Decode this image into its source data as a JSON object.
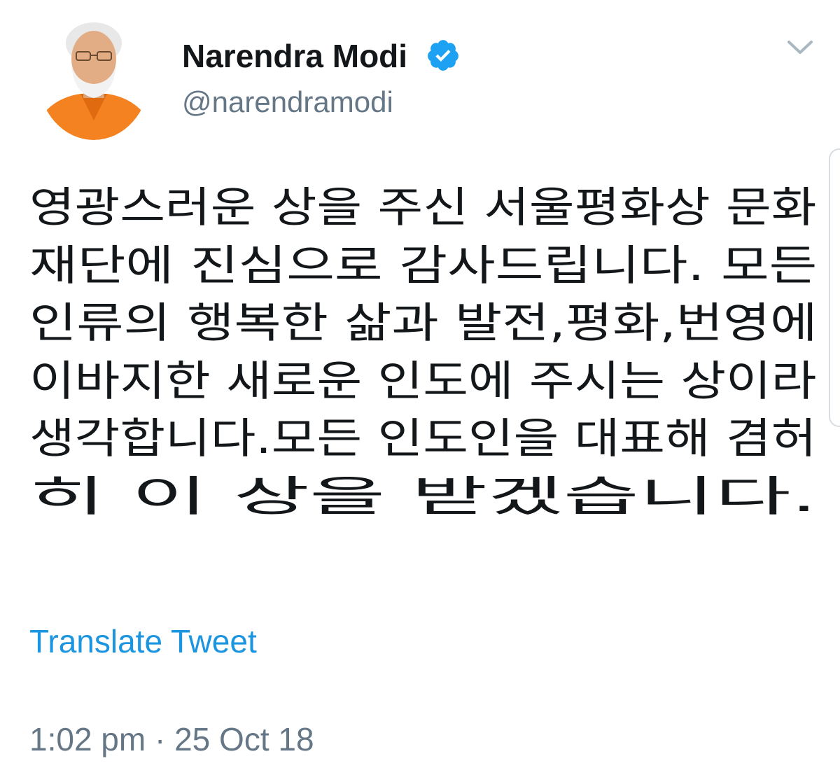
{
  "tweet": {
    "author": {
      "name": "Narendra Modi",
      "handle": "@narendramodi",
      "verified": true,
      "avatar_icon": "profile-photo"
    },
    "text_lines": [
      "영광스러운 상을 주신 서울평화상 문화",
      "재단에 진심으로 감사드립니다. 모든",
      "인류의 행복한 삶과 발전,평화,번영에",
      "이바지한 새로운 인도에 주시는 상이라",
      "생각합니다.모든 인도인을 대표해 겸허",
      "히 이 상을 받겠습니다."
    ],
    "translate_label": "Translate Tweet",
    "timestamp": "1:02 pm · 25 Oct 18",
    "menu_icon": "chevron-down-icon"
  },
  "colors": {
    "text": "#14171a",
    "secondary": "#657786",
    "link": "#1b95e0",
    "verified": "#1da1f2",
    "avatar_accent": "#f58220"
  }
}
